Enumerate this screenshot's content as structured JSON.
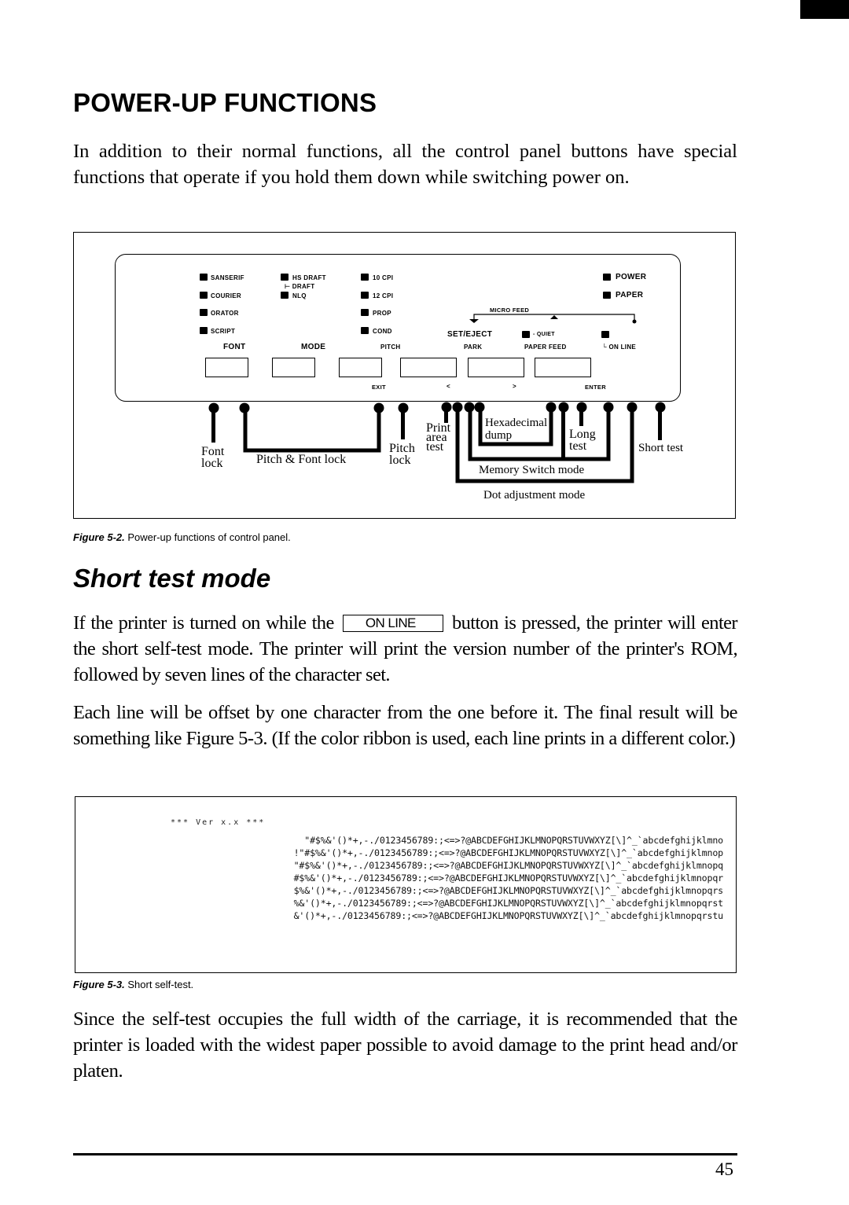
{
  "page": {
    "heading": "POWER-UP FUNCTIONS",
    "intro": "In addition to their normal functions, all the control panel buttons have special functions that operate if you hold them down while switching power on.",
    "page_number": "45"
  },
  "figure_5_2": {
    "caption_label": "Figure 5-2.",
    "caption_text": " Power-up functions of control panel.",
    "panel": {
      "font_leds": [
        "SANSERIF",
        "COURIER",
        "ORATOR",
        "SCRIPT"
      ],
      "mode_leds": [
        "HS DRAFT",
        "DRAFT",
        "NLQ"
      ],
      "pitch_leds": [
        "10 CPI",
        "12 CPI",
        "PROP",
        "COND"
      ],
      "status_leds": [
        "POWER",
        "PAPER"
      ],
      "micro_feed": "MICRO FEED",
      "quiet": "- QUIET",
      "button_labels": [
        "FONT",
        "MODE",
        "PITCH",
        "SET/EJECT",
        "PARK",
        "PAPER FEED",
        "ON LINE"
      ],
      "sub_labels": [
        "EXIT",
        "<",
        ">",
        "ENTER"
      ]
    },
    "functions": {
      "font_lock": "Font\nlock",
      "pitch_font_lock": "Pitch & Font lock",
      "pitch_lock": "Pitch\nlock",
      "print_area_test": "Print\narea\ntest",
      "hex_dump": "Hexadecimal\ndump",
      "long_test": "Long\ntest",
      "memory_switch": "Memory Switch mode",
      "dot_adjust": "Dot adjustment mode",
      "short_test": "Short test"
    }
  },
  "section": {
    "heading": "Short test mode",
    "p1_before": "If the printer is turned on while the ",
    "p1_button": "ON LINE",
    "p1_after": " button is pressed, the printer will enter the short self-test mode. The printer will print the version number of the printer's ROM, followed by seven lines of the character set.",
    "p2": "Each line will be offset by one character from the one before it. The final result will be something like Figure 5-3. (If the color ribbon is used, each line prints in a different color.)",
    "p3": "Since the self-test occupies the full width of the carriage, it is recommended that the printer is loaded with the widest paper possible to avoid damage to the print head and/or platen."
  },
  "figure_5_3": {
    "caption_label": "Figure 5-3.",
    "caption_text": " Short self-test.",
    "version_line": "*** Ver x.x ***",
    "lines": [
      " \"#$%&'()*+,-./0123456789:;<=>?@ABCDEFGHIJKLMNOPQRSTUVWXYZ[\\]^_`abcdefghijklmno",
      "!\"#$%&'()*+,-./0123456789:;<=>?@ABCDEFGHIJKLMNOPQRSTUVWXYZ[\\]^_`abcdefghijklmnop",
      "\"#$%&'()*+,-./0123456789:;<=>?@ABCDEFGHIJKLMNOPQRSTUVWXYZ[\\]^_`abcdefghijklmnopq",
      "#$%&'()*+,-./0123456789:;<=>?@ABCDEFGHIJKLMNOPQRSTUVWXYZ[\\]^_`abcdefghijklmnopqr",
      "$%&'()*+,-./0123456789:;<=>?@ABCDEFGHIJKLMNOPQRSTUVWXYZ[\\]^_`abcdefghijklmnopqrs",
      "%&'()*+,-./0123456789:;<=>?@ABCDEFGHIJKLMNOPQRSTUVWXYZ[\\]^_`abcdefghijklmnopqrst",
      "&'()*+,-./0123456789:;<=>?@ABCDEFGHIJKLMNOPQRSTUVWXYZ[\\]^_`abcdefghijklmnopqrstu"
    ]
  }
}
